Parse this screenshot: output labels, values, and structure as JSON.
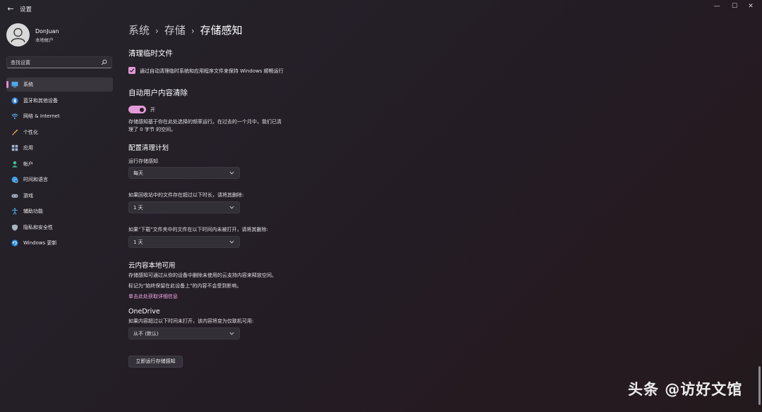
{
  "window": {
    "back_symbol": "←",
    "title": "设置",
    "controls": {
      "minimize": "—",
      "maximize": "☐",
      "close": "✕"
    }
  },
  "user": {
    "name": "DonJuan",
    "account_type": "本地帐户"
  },
  "search": {
    "placeholder": "查找设置"
  },
  "sidebar": {
    "items": [
      {
        "label": "系统",
        "icon": "system-icon",
        "active": true
      },
      {
        "label": "蓝牙和其他设备",
        "icon": "bluetooth-icon"
      },
      {
        "label": "网络 & Internet",
        "icon": "wifi-icon"
      },
      {
        "label": "个性化",
        "icon": "brush-icon"
      },
      {
        "label": "应用",
        "icon": "apps-icon"
      },
      {
        "label": "帐户",
        "icon": "account-icon"
      },
      {
        "label": "时间和语言",
        "icon": "globe-clock-icon"
      },
      {
        "label": "游戏",
        "icon": "gamepad-icon"
      },
      {
        "label": "辅助功能",
        "icon": "accessibility-icon"
      },
      {
        "label": "隐私和安全性",
        "icon": "shield-icon"
      },
      {
        "label": "Windows 更新",
        "icon": "windows-update-icon"
      }
    ]
  },
  "breadcrumb": {
    "items": [
      "系统",
      "存储",
      "存储感知"
    ],
    "separator": "›"
  },
  "temp_files": {
    "heading": "清理临时文件",
    "checkbox_label": "通过自动清理临时系统和应用程序文件来保持 Windows 顺畅运行",
    "checked": true
  },
  "auto_cleanup": {
    "heading": "自动用户内容清除",
    "toggle_label": "开",
    "toggle_on": true,
    "desc_line1": "存储感知基于你在此处选择的频率运行。在过去的一个月中，我们已清",
    "desc_line2": "理了 0 字节 的空间。"
  },
  "schedule": {
    "heading": "配置清理计划",
    "run_label": "运行存储感知",
    "run_value": "每天",
    "recycle_label": "如果回收站中的文件存在超过以下时长，请将其删除:",
    "recycle_value": "1 天",
    "downloads_label": "如果\"下载\"文件夹中的文件在以下时间内未被打开，请将其删除:",
    "downloads_value": "1 天"
  },
  "cloud": {
    "heading": "云内容本地可用",
    "line1": "存储感知可通过从你的设备中删除未使用的云支持内容来释放空间。",
    "line2": "标记为\"始终保留在此设备上\"的内容不会受到影响。",
    "link": "单击此处获取详细信息"
  },
  "onedrive": {
    "heading": "OneDrive",
    "label": "如果内容超过以下时间未打开，该内容将变为仅联机可用:",
    "value": "从不 (默认)"
  },
  "run_now_label": "立即运行存储感知",
  "watermark": "头条 @访好文馆",
  "colors": {
    "accent": "#e49ad8",
    "link": "#f2a6e6"
  }
}
